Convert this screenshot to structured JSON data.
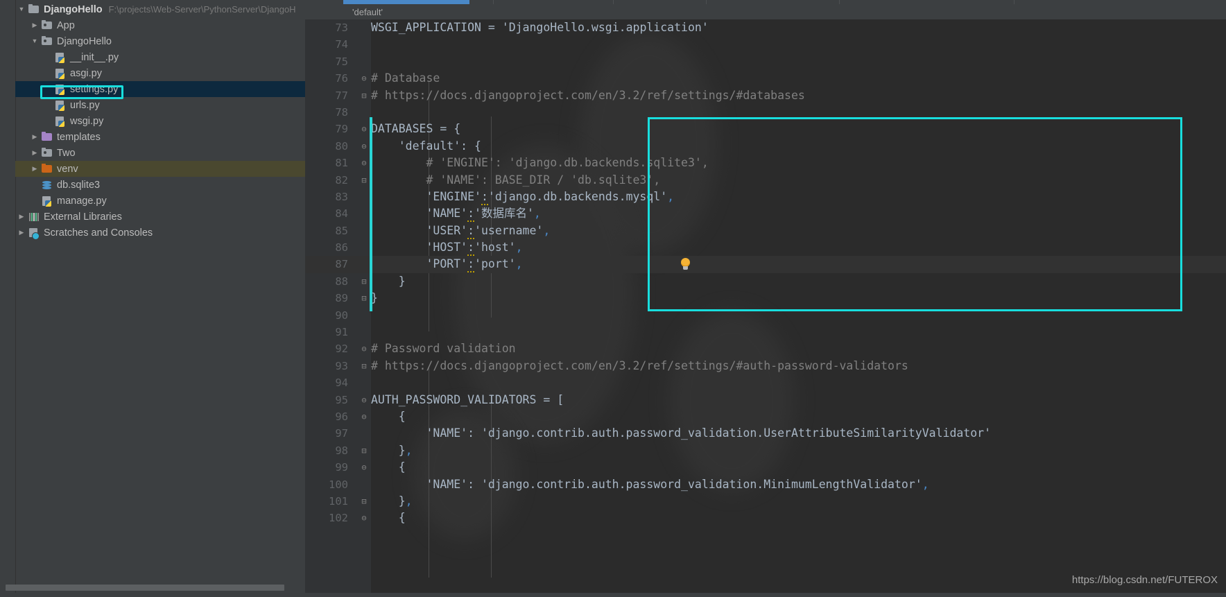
{
  "project_tree": {
    "items": [
      {
        "indent": 0,
        "arrow": "down",
        "icon": "folder-icon",
        "label": "DjangoHello",
        "bold": true,
        "hint": "F:\\projects\\Web-Server\\PythonServer\\DjangoH",
        "state": "normal"
      },
      {
        "indent": 1,
        "arrow": "right",
        "icon": "folder-module-icon",
        "label": "App",
        "bold": false,
        "hint": "",
        "state": "normal"
      },
      {
        "indent": 1,
        "arrow": "down",
        "icon": "folder-module-icon",
        "label": "DjangoHello",
        "bold": false,
        "hint": "",
        "state": "normal"
      },
      {
        "indent": 2,
        "arrow": "none",
        "icon": "python-file-icon",
        "label": "__init__.py",
        "bold": false,
        "hint": "",
        "state": "normal"
      },
      {
        "indent": 2,
        "arrow": "none",
        "icon": "python-file-icon",
        "label": "asgi.py",
        "bold": false,
        "hint": "",
        "state": "normal"
      },
      {
        "indent": 2,
        "arrow": "none",
        "icon": "python-file-icon",
        "label": "settings.py",
        "bold": false,
        "hint": "",
        "state": "selected"
      },
      {
        "indent": 2,
        "arrow": "none",
        "icon": "python-file-icon",
        "label": "urls.py",
        "bold": false,
        "hint": "",
        "state": "normal"
      },
      {
        "indent": 2,
        "arrow": "none",
        "icon": "python-file-icon",
        "label": "wsgi.py",
        "bold": false,
        "hint": "",
        "state": "normal"
      },
      {
        "indent": 1,
        "arrow": "right",
        "icon": "folder-templates-icon",
        "label": "templates",
        "bold": false,
        "hint": "",
        "state": "normal"
      },
      {
        "indent": 1,
        "arrow": "right",
        "icon": "folder-module-icon",
        "label": "Two",
        "bold": false,
        "hint": "",
        "state": "normal"
      },
      {
        "indent": 1,
        "arrow": "right",
        "icon": "folder-venv-icon",
        "label": "venv",
        "bold": false,
        "hint": "",
        "state": "highlighted"
      },
      {
        "indent": 1,
        "arrow": "none",
        "icon": "sqlite-db-icon",
        "label": "db.sqlite3",
        "bold": false,
        "hint": "",
        "state": "normal"
      },
      {
        "indent": 1,
        "arrow": "none",
        "icon": "python-file-icon",
        "label": "manage.py",
        "bold": false,
        "hint": "",
        "state": "normal"
      },
      {
        "indent": 0,
        "arrow": "right",
        "icon": "external-libraries-icon",
        "label": "External Libraries",
        "bold": false,
        "hint": "",
        "state": "normal"
      },
      {
        "indent": 0,
        "arrow": "right",
        "icon": "scratches-icon",
        "label": "Scratches and Consoles",
        "bold": false,
        "hint": "",
        "state": "normal"
      }
    ]
  },
  "editor": {
    "breadcrumb": "'default'",
    "first_line_number": 73,
    "current_line_number": 87,
    "lines": [
      {
        "n": 73,
        "fold": "",
        "tokens": [
          {
            "t": "WSGI_APPLICATION",
            "c": "id"
          },
          {
            "t": " = ",
            "c": "op"
          },
          {
            "t": "'DjangoHello.wsgi.application'",
            "c": "str"
          }
        ]
      },
      {
        "n": 74,
        "fold": "",
        "tokens": []
      },
      {
        "n": 75,
        "fold": "",
        "tokens": []
      },
      {
        "n": 76,
        "fold": "-",
        "tokens": [
          {
            "t": "# Database",
            "c": "cm"
          }
        ]
      },
      {
        "n": 77,
        "fold": "+",
        "tokens": [
          {
            "t": "# https://docs.djangoproject.com/en/3.2/ref/settings/#databases",
            "c": "cm"
          }
        ]
      },
      {
        "n": 78,
        "fold": "",
        "tokens": []
      },
      {
        "n": 79,
        "fold": "-",
        "tokens": [
          {
            "t": "DATABASES = {",
            "c": "id"
          }
        ]
      },
      {
        "n": 80,
        "fold": "-",
        "tokens": [
          {
            "t": "    'default': {",
            "c": "str"
          }
        ]
      },
      {
        "n": 81,
        "fold": "-",
        "tokens": [
          {
            "t": "        # 'ENGINE': 'django.db.backends.sqlite3',",
            "c": "cm"
          }
        ]
      },
      {
        "n": 82,
        "fold": "+",
        "tokens": [
          {
            "t": "        # 'NAME': BASE_DIR / 'db.sqlite3',",
            "c": "cm"
          }
        ]
      },
      {
        "n": 83,
        "fold": "",
        "tokens": [
          {
            "t": "        'ENGINE'",
            "c": "str"
          },
          {
            "t": ":",
            "c": "op warn"
          },
          {
            "t": "'django.db.backends.mysql'",
            "c": "str"
          },
          {
            "t": ",",
            "c": "comma"
          }
        ]
      },
      {
        "n": 84,
        "fold": "",
        "tokens": [
          {
            "t": "        'NAME'",
            "c": "str"
          },
          {
            "t": ":",
            "c": "op warn"
          },
          {
            "t": "'数据库名'",
            "c": "str"
          },
          {
            "t": ",",
            "c": "comma"
          }
        ]
      },
      {
        "n": 85,
        "fold": "",
        "tokens": [
          {
            "t": "        'USER'",
            "c": "str"
          },
          {
            "t": ":",
            "c": "op warn"
          },
          {
            "t": "'username'",
            "c": "str"
          },
          {
            "t": ",",
            "c": "comma"
          }
        ]
      },
      {
        "n": 86,
        "fold": "",
        "tokens": [
          {
            "t": "        'HOST'",
            "c": "str"
          },
          {
            "t": ":",
            "c": "op warn"
          },
          {
            "t": "'host'",
            "c": "str"
          },
          {
            "t": ",",
            "c": "comma"
          }
        ]
      },
      {
        "n": 87,
        "fold": "",
        "tokens": [
          {
            "t": "        'PORT'",
            "c": "str"
          },
          {
            "t": ":",
            "c": "op warn"
          },
          {
            "t": "'port'",
            "c": "str"
          },
          {
            "t": ",",
            "c": "comma"
          }
        ]
      },
      {
        "n": 88,
        "fold": "+",
        "tokens": [
          {
            "t": "    }",
            "c": "id"
          }
        ]
      },
      {
        "n": 89,
        "fold": "+",
        "tokens": [
          {
            "t": "}",
            "c": "id"
          }
        ]
      },
      {
        "n": 90,
        "fold": "",
        "tokens": []
      },
      {
        "n": 91,
        "fold": "",
        "tokens": []
      },
      {
        "n": 92,
        "fold": "-",
        "tokens": [
          {
            "t": "# Password validation",
            "c": "cm"
          }
        ]
      },
      {
        "n": 93,
        "fold": "+",
        "tokens": [
          {
            "t": "# https://docs.djangoproject.com/en/3.2/ref/settings/#auth-password-validators",
            "c": "cm"
          }
        ]
      },
      {
        "n": 94,
        "fold": "",
        "tokens": []
      },
      {
        "n": 95,
        "fold": "-",
        "tokens": [
          {
            "t": "AUTH_PASSWORD_VALIDATORS = [",
            "c": "id"
          }
        ]
      },
      {
        "n": 96,
        "fold": "-",
        "tokens": [
          {
            "t": "    {",
            "c": "id"
          }
        ]
      },
      {
        "n": 97,
        "fold": "",
        "tokens": [
          {
            "t": "        'NAME': 'django.contrib.auth.password_validation.UserAttributeSimilarityValidator'",
            "c": "str"
          }
        ]
      },
      {
        "n": 98,
        "fold": "+",
        "tokens": [
          {
            "t": "    }",
            "c": "id"
          },
          {
            "t": ",",
            "c": "comma"
          }
        ]
      },
      {
        "n": 99,
        "fold": "-",
        "tokens": [
          {
            "t": "    {",
            "c": "id"
          }
        ]
      },
      {
        "n": 100,
        "fold": "",
        "tokens": [
          {
            "t": "        'NAME': 'django.contrib.auth.password_validation.MinimumLengthValidator'",
            "c": "str"
          },
          {
            "t": ",",
            "c": "comma"
          }
        ]
      },
      {
        "n": 101,
        "fold": "+",
        "tokens": [
          {
            "t": "    }",
            "c": "id"
          },
          {
            "t": ",",
            "c": "comma"
          }
        ]
      },
      {
        "n": 102,
        "fold": "-",
        "tokens": [
          {
            "t": "    {",
            "c": "id"
          }
        ]
      }
    ]
  },
  "annotations": {
    "selection_box_color": "#18dede",
    "database_box_color": "#18dede",
    "change_marker_color": "#29d6d6",
    "bulb_icon": "intention-bulb-icon"
  },
  "watermark": "https://blog.csdn.net/FUTEROX"
}
